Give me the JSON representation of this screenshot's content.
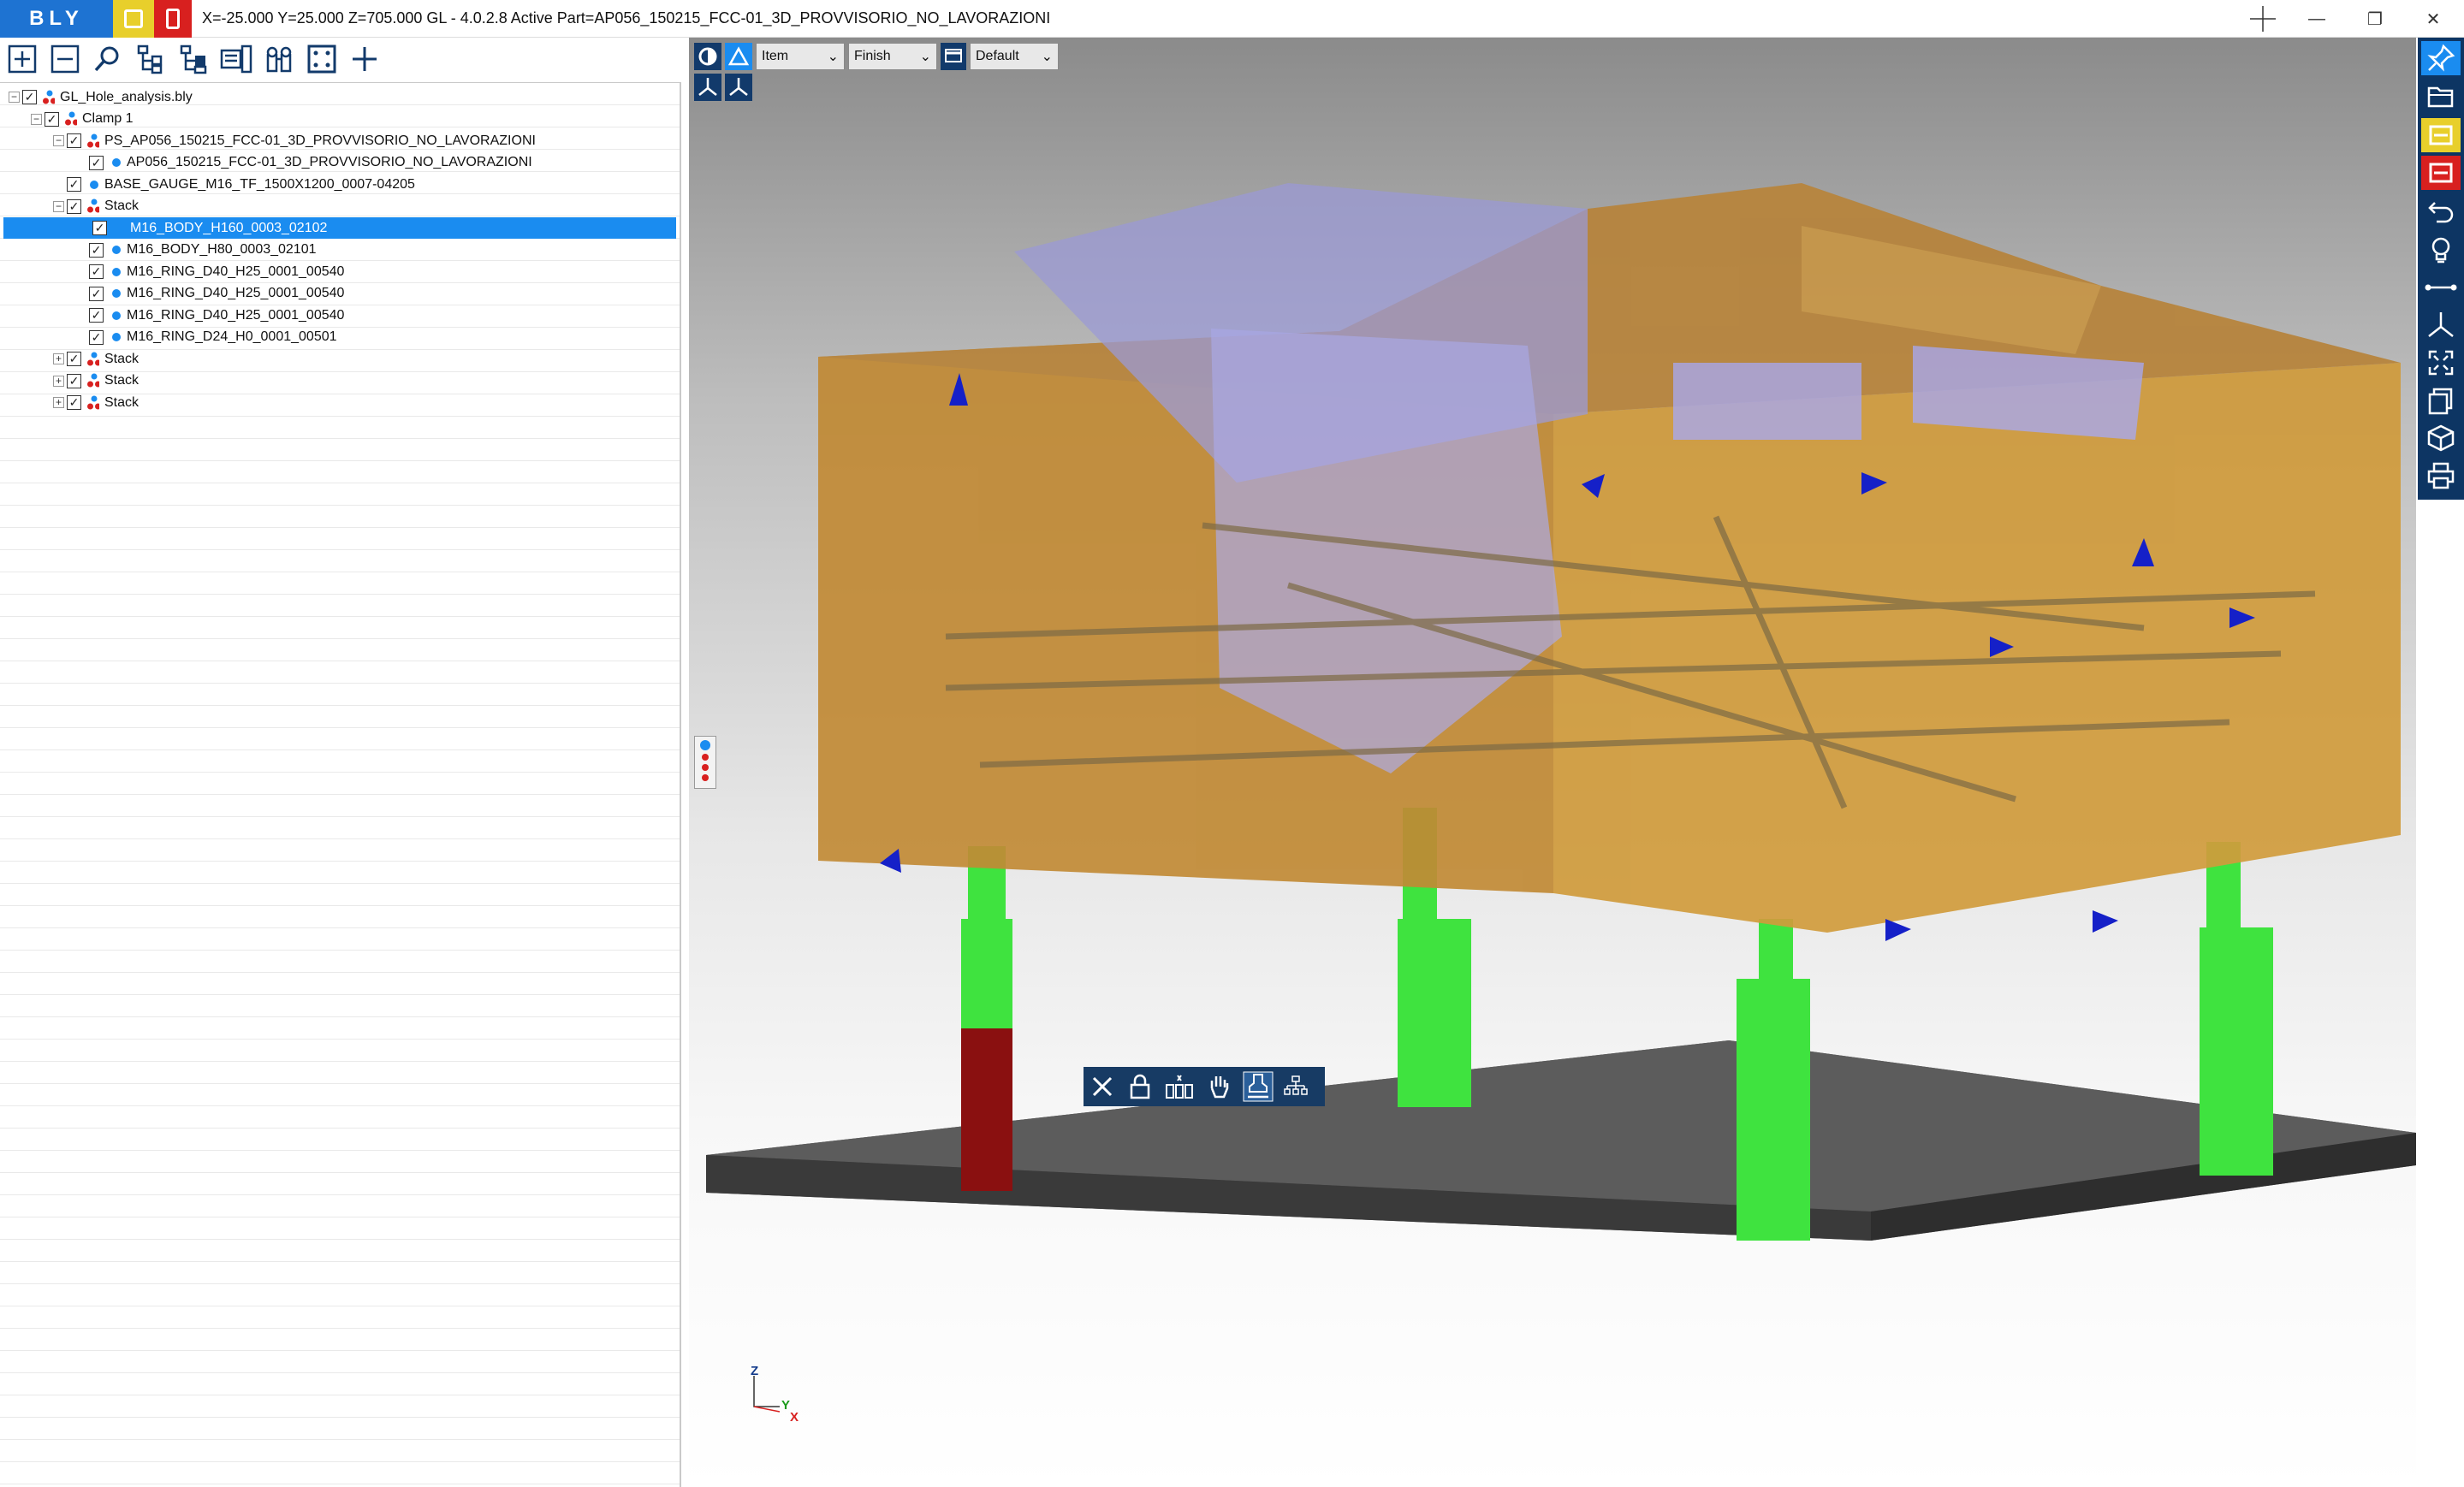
{
  "titlebar": {
    "logo": "BLY",
    "coords_and_title": "X=-25.000 Y=25.000 Z=705.000    GL - 4.0.2.8 Active Part=AP056_150215_FCC-01_3D_PROVVISORIO_NO_LAVORAZIONI",
    "minimize": "—",
    "restore": "❐",
    "close": "✕"
  },
  "left_toolbar": {
    "icons": [
      "expand-all-icon",
      "collapse-all-icon",
      "search-icon",
      "tree-hierarchy-icon",
      "tree-add-icon",
      "properties-icon",
      "binoculars-icon",
      "select-frame-icon",
      "add-icon"
    ]
  },
  "tree": {
    "items": [
      {
        "label": "GL_Hole_analysis.bly",
        "level": 0,
        "expander": "−",
        "checked": true,
        "icon": "assembly"
      },
      {
        "label": "Clamp 1",
        "level": 1,
        "expander": "−",
        "checked": true,
        "icon": "assembly"
      },
      {
        "label": "PS_AP056_150215_FCC-01_3D_PROVVISORIO_NO_LAVORAZIONI",
        "level": 2,
        "expander": "−",
        "checked": true,
        "icon": "assembly"
      },
      {
        "label": "AP056_150215_FCC-01_3D_PROVVISORIO_NO_LAVORAZIONI",
        "level": 3,
        "expander": "",
        "checked": true,
        "icon": "part"
      },
      {
        "label": "BASE_GAUGE_M16_TF_1500X1200_0007-04205",
        "level": 2,
        "expander": "",
        "checked": true,
        "icon": "part"
      },
      {
        "label": "Stack",
        "level": 2,
        "expander": "−",
        "checked": true,
        "icon": "assembly"
      },
      {
        "label": "M16_BODY_H160_0003_02102",
        "level": 3,
        "expander": "",
        "checked": true,
        "icon": "part",
        "selected": true
      },
      {
        "label": "M16_BODY_H80_0003_02101",
        "level": 3,
        "expander": "",
        "checked": true,
        "icon": "part"
      },
      {
        "label": "M16_RING_D40_H25_0001_00540",
        "level": 3,
        "expander": "",
        "checked": true,
        "icon": "part"
      },
      {
        "label": "M16_RING_D40_H25_0001_00540",
        "level": 3,
        "expander": "",
        "checked": true,
        "icon": "part"
      },
      {
        "label": "M16_RING_D40_H25_0001_00540",
        "level": 3,
        "expander": "",
        "checked": true,
        "icon": "part"
      },
      {
        "label": "M16_RING_D24_H0_0001_00501",
        "level": 3,
        "expander": "",
        "checked": true,
        "icon": "part"
      },
      {
        "label": "Stack",
        "level": 2,
        "expander": "+",
        "checked": true,
        "icon": "assembly"
      },
      {
        "label": "Stack",
        "level": 2,
        "expander": "+",
        "checked": true,
        "icon": "assembly"
      },
      {
        "label": "Stack",
        "level": 2,
        "expander": "+",
        "checked": true,
        "icon": "assembly"
      }
    ]
  },
  "viewport_toolbar": {
    "mode_select": "Item",
    "quality_select": "Finish",
    "view_select": "Default"
  },
  "floating_toolbar": {
    "icons": [
      "close-icon",
      "lock-icon",
      "distribute-icon",
      "hand-icon",
      "stamp-icon",
      "hierarchy-icon"
    ]
  },
  "right_toolbar": {
    "icons": [
      "pin-icon",
      "open-folder-icon",
      "yellow-panel-icon",
      "red-panel-icon",
      "undo-icon",
      "lightbulb-icon",
      "measure-icon",
      "axes-icon",
      "fit-view-icon",
      "view-box-icon",
      "cube-icon",
      "print-icon"
    ]
  },
  "axis_triad": {
    "z": "Z",
    "y": "Y",
    "x": "X"
  },
  "colors": {
    "accent": "#1a8cf0",
    "toolbar_dark": "#0d3563",
    "part_body": "#c8902f",
    "support_green": "#39e03a",
    "support_red": "#8a1010",
    "marker_blue": "#1520c8"
  }
}
